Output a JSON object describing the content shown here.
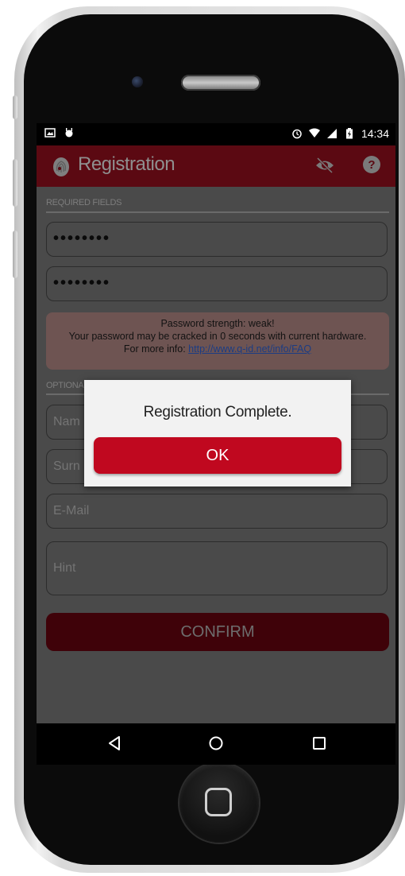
{
  "status_bar": {
    "time": "14:34"
  },
  "app_bar": {
    "title": "Registration"
  },
  "sections": {
    "required_label": "REQUIRED FIELDS",
    "optional_label": "OPTIONAL"
  },
  "fields": {
    "password_mask": "••••••••",
    "password_confirm_mask": "••••••••",
    "name_placeholder": "Nam",
    "surname_placeholder": "Surn",
    "email_placeholder": "E-Mail",
    "hint_placeholder": "Hint"
  },
  "warning": {
    "line1": "Password strength: weak!",
    "line2": "Your password may be cracked in 0 seconds with current hardware.",
    "line3_prefix": "For more info: ",
    "link": "http://www.q-id.net/info/FAQ"
  },
  "confirm_label": "CONFIRM",
  "dialog": {
    "message": "Registration Complete.",
    "ok_label": "OK"
  },
  "colors": {
    "accent": "#c0081f",
    "app_bar": "#5b0912"
  }
}
